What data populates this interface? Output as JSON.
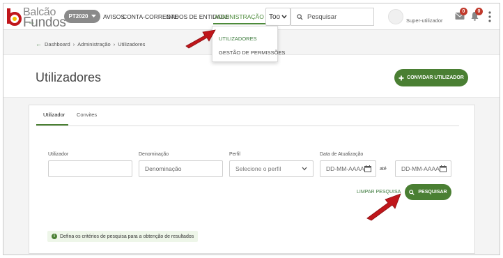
{
  "logo": {
    "line1": "Balcão",
    "line2": "Fundos",
    "small": "dos"
  },
  "topbar": {
    "program": "PT2020",
    "nav": [
      "AVISOS",
      "CONTA-CORRENTE",
      "DADOS DE ENTIDADE"
    ],
    "active_nav": "ADMINISTRAÇÃO",
    "tod_label": "Too",
    "search_placeholder": "Pesquisar",
    "user_role": "Super-utilizador",
    "mail_count": "0",
    "notif_count": "0"
  },
  "dropdown": {
    "items": [
      "UTILIZADORES",
      "GESTÃO DE PERMISSÕES"
    ]
  },
  "breadcrumb": {
    "items": [
      "Dashboard",
      "Administração",
      "Utilizadores"
    ]
  },
  "page": {
    "title": "Utilizadores",
    "invite_button": "CONVIDAR UTILIZADOR"
  },
  "tabs": [
    "Utilizador",
    "Convites"
  ],
  "form": {
    "utilizador_label": "Utilizador",
    "utilizador_value": "",
    "denominacao_label": "Denominação",
    "denominacao_placeholder": "Denominação",
    "perfil_label": "Perfil",
    "perfil_value": "Selecione o perfil",
    "data_label": "Data de Atualização",
    "date_from_placeholder": "DD-MM-AAAA",
    "ate": "até",
    "date_to_placeholder": "DD-MM-AAAA",
    "clear_link": "LIMPAR PESQUISA",
    "search_button": "PESQUISAR"
  },
  "info": {
    "text": "Defina os critérios de pesquisa para a obtenção de resultados"
  },
  "colors": {
    "brand_green": "#4a7f33",
    "badge_red": "#c0392b",
    "annotation_red": "#c0161b"
  }
}
